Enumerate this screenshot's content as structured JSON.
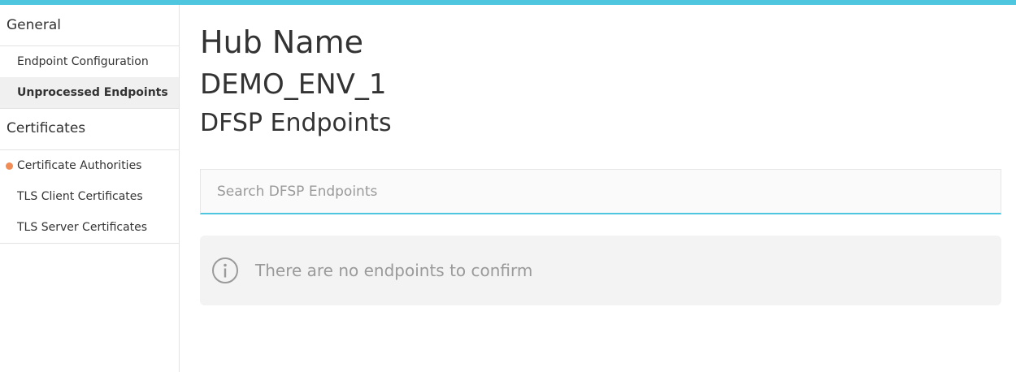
{
  "sidebar": {
    "general_title": "General",
    "general_items": [
      {
        "label": "Endpoint Configuration"
      },
      {
        "label": "Unprocessed Endpoints"
      }
    ],
    "certificates_title": "Certificates",
    "certificate_items": [
      {
        "label": "Certificate Authorities"
      },
      {
        "label": "TLS Client Certificates"
      },
      {
        "label": "TLS Server Certificates"
      }
    ]
  },
  "main": {
    "hub_label": "Hub Name",
    "hub_value": "DEMO_ENV_1",
    "section_heading": "DFSP Endpoints",
    "search": {
      "placeholder": "Search DFSP Endpoints",
      "value": ""
    },
    "empty_message": "There are no endpoints to confirm"
  },
  "colors": {
    "accent": "#4fc6e0",
    "notification_dot": "#f28c56"
  },
  "icons": {
    "empty_state": "info-circle-icon"
  }
}
